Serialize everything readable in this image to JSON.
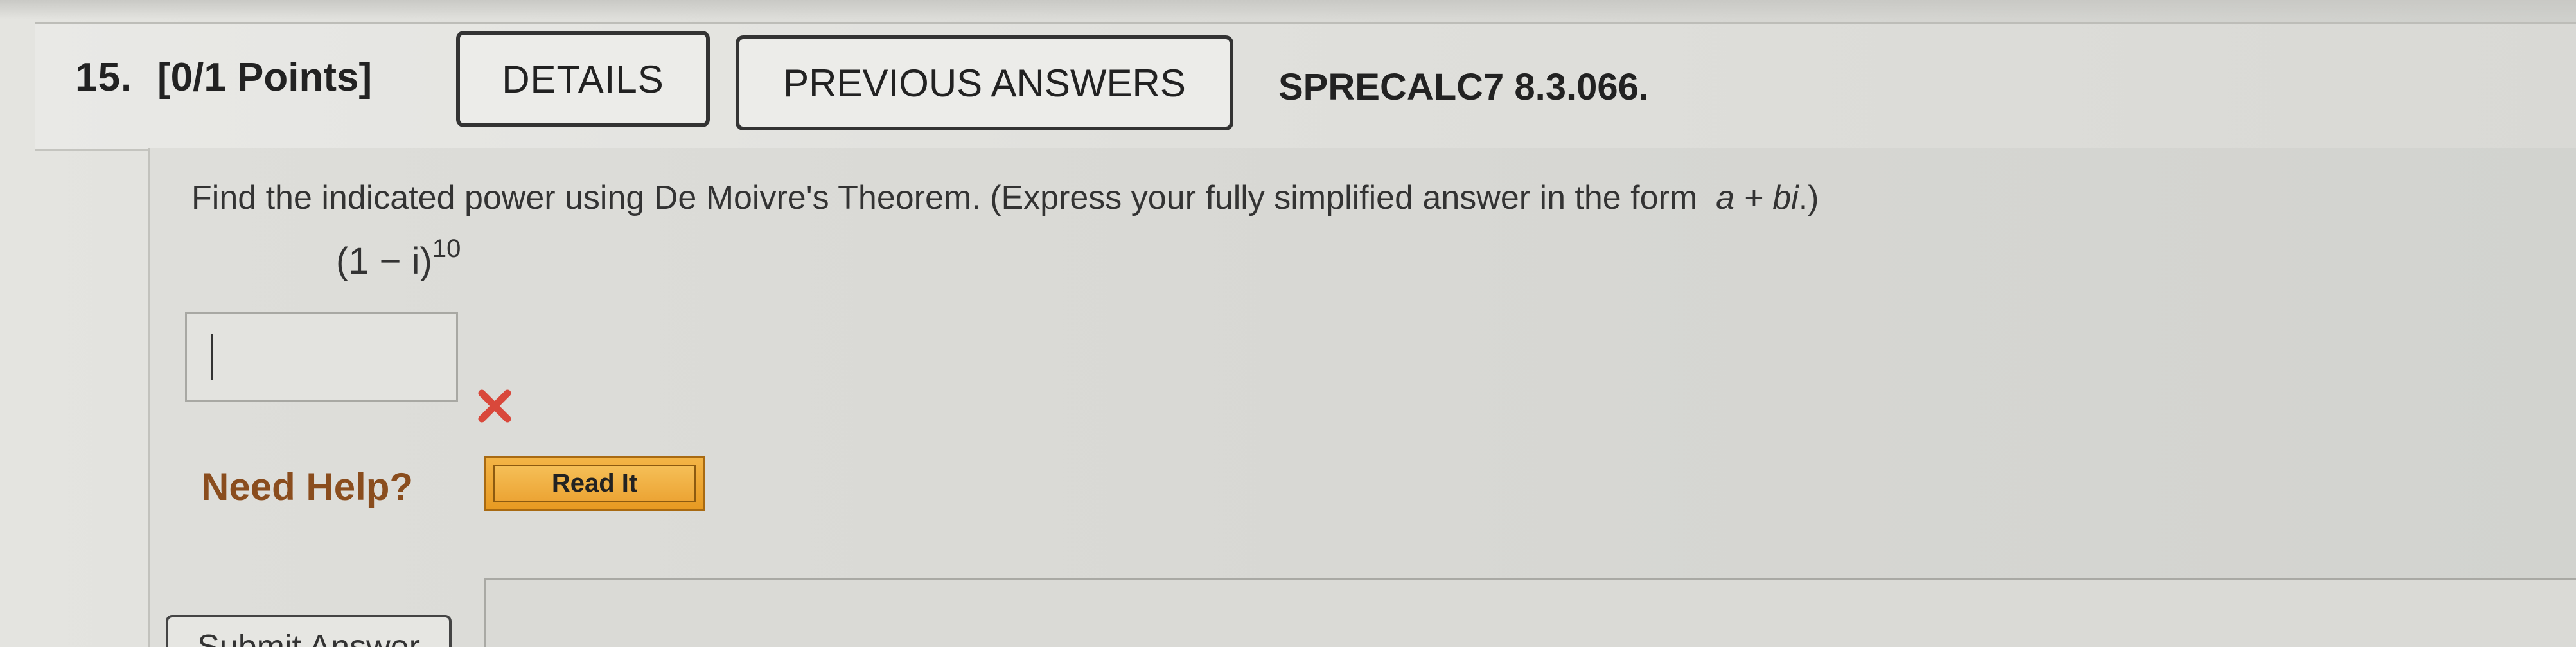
{
  "question": {
    "number": "15.",
    "points": "[0/1 Points]",
    "details_label": "DETAILS",
    "previous_answers_label": "PREVIOUS ANSWERS",
    "source": "SPRECALC7 8.3.066."
  },
  "body": {
    "prompt_text": "Find the indicated power using De Moivre's Theorem. (Express your fully simplified answer in the form",
    "prompt_form": "a + bi",
    "prompt_end": ".)",
    "expression": "(1 − i)",
    "exponent": "10"
  },
  "answer": {
    "value": "",
    "status": "incorrect",
    "status_icon": "x-mark-icon",
    "status_color": "#d9483b"
  },
  "help": {
    "label": "Need Help?",
    "read_it_label": "Read It"
  },
  "submit": {
    "label": "Submit Answer"
  }
}
